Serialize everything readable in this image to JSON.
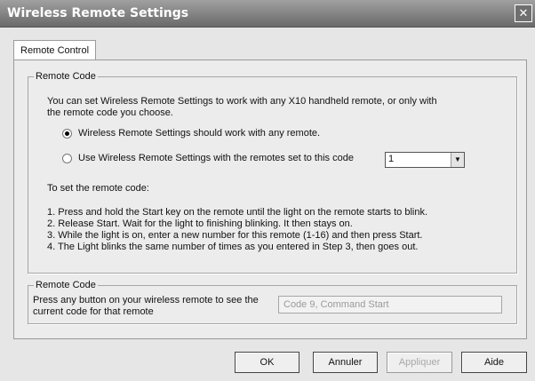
{
  "window": {
    "title": "Wireless Remote Settings",
    "close_label": "✕"
  },
  "tab": {
    "label": "Remote Control"
  },
  "group1": {
    "legend": "Remote Code",
    "intro": [
      "You can set Wireless Remote Settings to work with any X10 handheld remote, or only with",
      "the remote code you choose."
    ],
    "option_any": "Wireless Remote Settings should work with any remote.",
    "option_code": "Use Wireless Remote Settings with the remotes set to this code",
    "code_value": "1",
    "howto_heading": "To set the remote code:",
    "steps": [
      "1. Press and hold the Start key on the remote until the light on the remote starts to blink.",
      "2. Release Start. Wait for the light to finishing blinking. It then stays on.",
      "3. While the light is on, enter a new number for this remote (1-16) and then press Start.",
      "4. The Light blinks the same number of times as you entered in Step 3, then goes out."
    ]
  },
  "group2": {
    "legend": "Remote Code",
    "description": [
      "Press any button on your wireless remote to see the",
      "current code for that remote"
    ],
    "current_code": "Code 9, Command Start"
  },
  "buttons": {
    "ok": "OK",
    "cancel": "Annuler",
    "apply": "Appliquer",
    "help": "Aide"
  }
}
